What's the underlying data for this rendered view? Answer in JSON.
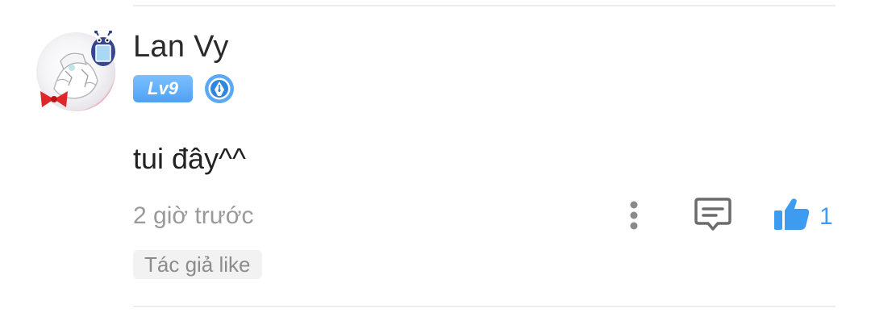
{
  "comment": {
    "author": "Lan Vy",
    "level_badge": "Lv9",
    "text": "tui đây^^",
    "time": "2 giờ trước",
    "like_count": "1",
    "author_like_tag": "Tác giả like"
  },
  "icons": {
    "avatar": "user-avatar",
    "author_badge": "pen-nib-badge-icon",
    "more": "vertical-dots-icon",
    "reply": "comment-icon",
    "like": "thumbs-up-icon"
  },
  "colors": {
    "accent": "#3d9cf0",
    "level_badge": "#5aa9f7",
    "meta_text": "#9a9a9a",
    "tag_bg": "#f2f2f2"
  }
}
